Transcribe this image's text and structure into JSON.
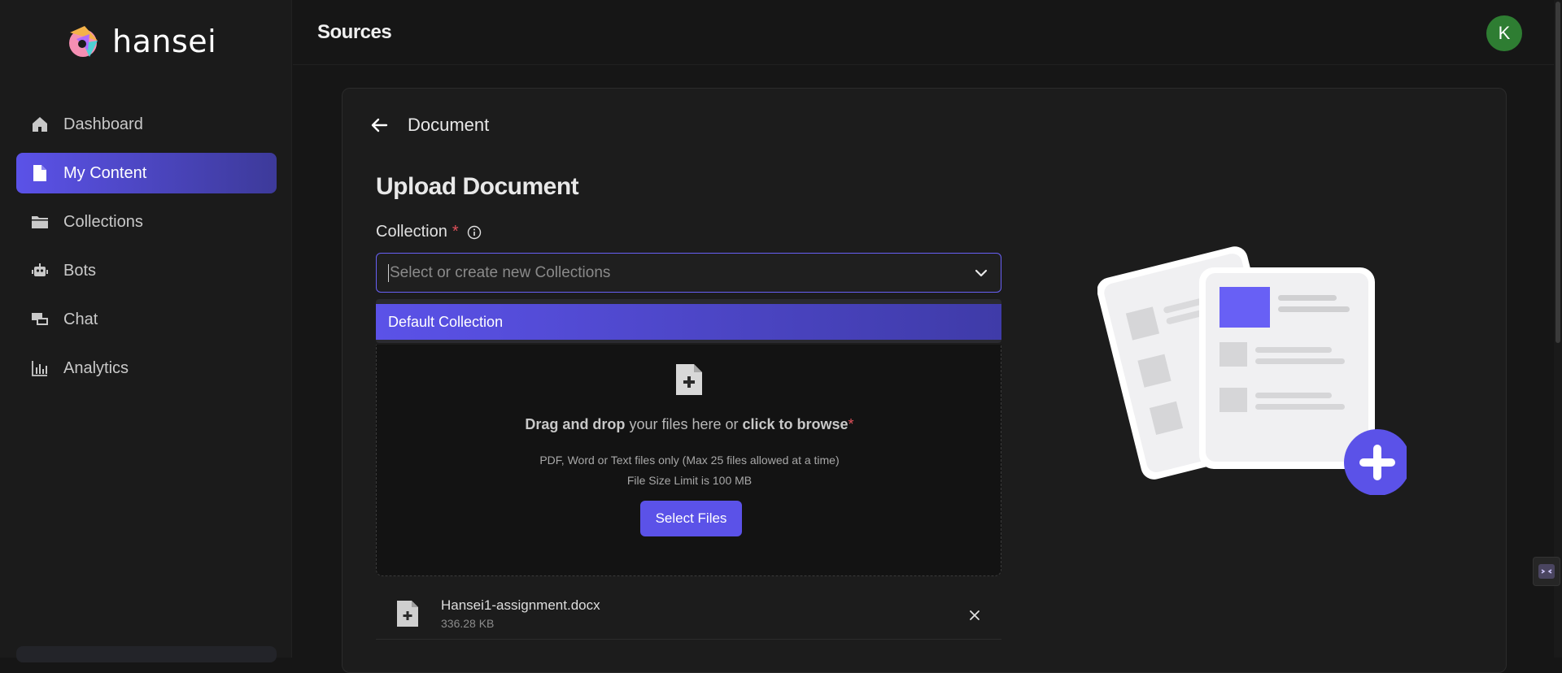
{
  "sidebar": {
    "logo_text": "hansei",
    "items": [
      {
        "label": "Dashboard",
        "icon": "home-icon"
      },
      {
        "label": "My Content",
        "icon": "document-icon",
        "active": true
      },
      {
        "label": "Collections",
        "icon": "folder-icon"
      },
      {
        "label": "Bots",
        "icon": "robot-icon"
      },
      {
        "label": "Chat",
        "icon": "chat-icon"
      },
      {
        "label": "Analytics",
        "icon": "bar-chart-icon"
      }
    ]
  },
  "header": {
    "title": "Sources",
    "avatar_initial": "K"
  },
  "page": {
    "back_label": "Document",
    "upload_title": "Upload Document",
    "collection_label": "Collection",
    "required_mark": "*",
    "collection_placeholder": "Select or create new Collections",
    "dropdown_options": [
      "Default Collection"
    ]
  },
  "dropzone": {
    "drag_bold": "Drag and drop",
    "drag_middle": " your files here or ",
    "browse_bold": "click to browse",
    "required_mark": "*",
    "file_types": "PDF, Word or Text files only (Max 25 files allowed at a time)",
    "size_limit": "File Size Limit is 100 MB",
    "select_button": "Select Files"
  },
  "files": [
    {
      "name": "Hansei1-assignment.docx",
      "size": "336.28 KB"
    }
  ],
  "colors": {
    "accent": "#5b52e8",
    "avatar": "#2e7d32",
    "required": "#e0505a",
    "background": "#161616"
  }
}
